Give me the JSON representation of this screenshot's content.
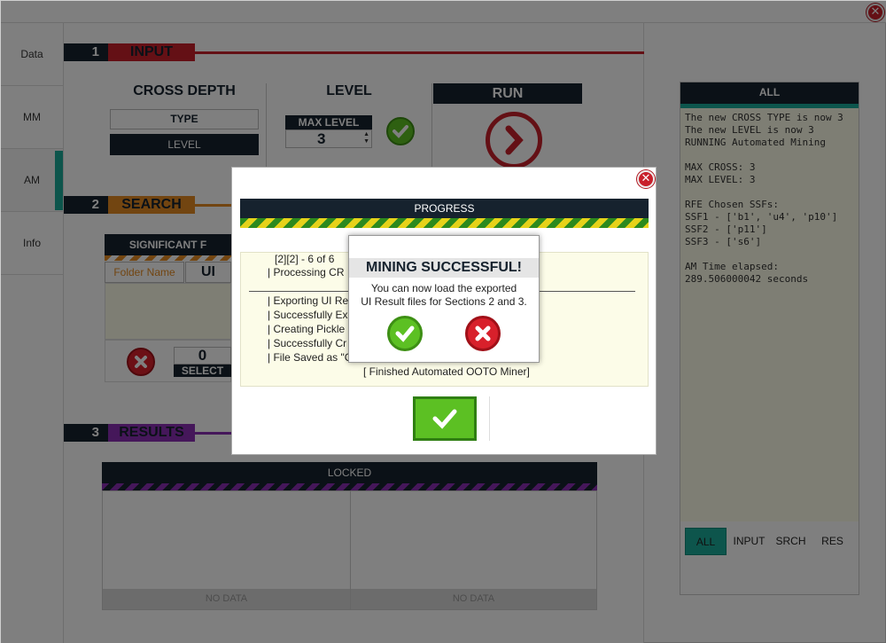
{
  "sidebar": {
    "items": [
      {
        "label": "Data"
      },
      {
        "label": "MM"
      },
      {
        "label": "AM"
      },
      {
        "label": "Info"
      }
    ],
    "active": "AM"
  },
  "sections": {
    "input": {
      "number": "1",
      "title": "INPUT",
      "color": "#c8202b"
    },
    "search": {
      "number": "2",
      "title": "SEARCH",
      "color": "#e58a22"
    },
    "results": {
      "number": "3",
      "title": "RESULTS",
      "color": "#8a2fb5"
    }
  },
  "input": {
    "cross_depth_label": "CROSS DEPTH",
    "type_label": "TYPE",
    "level_button": "LEVEL",
    "level_label": "LEVEL",
    "max_level_label": "MAX LEVEL",
    "max_level_value": "3",
    "run_label": "RUN"
  },
  "search": {
    "significant_label": "SIGNIFICANT F",
    "folder_name_placeholder": "Folder Name",
    "ui_label": "UI",
    "count_value": "0",
    "select_label": "SELECT"
  },
  "results": {
    "header": "LOCKED",
    "no_data_left": "NO DATA",
    "no_data_right": "NO DATA"
  },
  "right_panel": {
    "header": "ALL",
    "log": "The new CROSS TYPE is now 3\nThe new LEVEL is now 3\nRUNNING Automated Mining\n\nMAX CROSS: 3\nMAX LEVEL: 3\n\nRFE Chosen SSFs:\nSSF1 - ['b1', 'u4', 'p10']\nSSF2 - ['p11']\nSSF3 - ['s6']\n\nAM Time elapsed:\n289.506000042 seconds",
    "tabs": [
      "ALL",
      "INPUT",
      "SRCH",
      "RES"
    ],
    "active_tab": "ALL"
  },
  "progress_dialog": {
    "header": "PROGRESS",
    "lines": [
      "[2][2] - 6 of 6",
      "| Processing CR",
      "| Exporting UI Re",
      "| Successfully Ex",
      "| Creating Pickle",
      "| Successfully Cr",
      "| File Saved as \"C"
    ],
    "finished": "[ Finished Automated OOTO Miner]"
  },
  "message": {
    "title": "MINING SUCCESSFUL!",
    "line1": "You can now load the exported",
    "line2": "UI Result files for Sections 2 and 3."
  },
  "colors": {
    "dark": "#16222e",
    "teal": "#1aaa98",
    "red": "#c8202b",
    "green": "#5cc023"
  }
}
